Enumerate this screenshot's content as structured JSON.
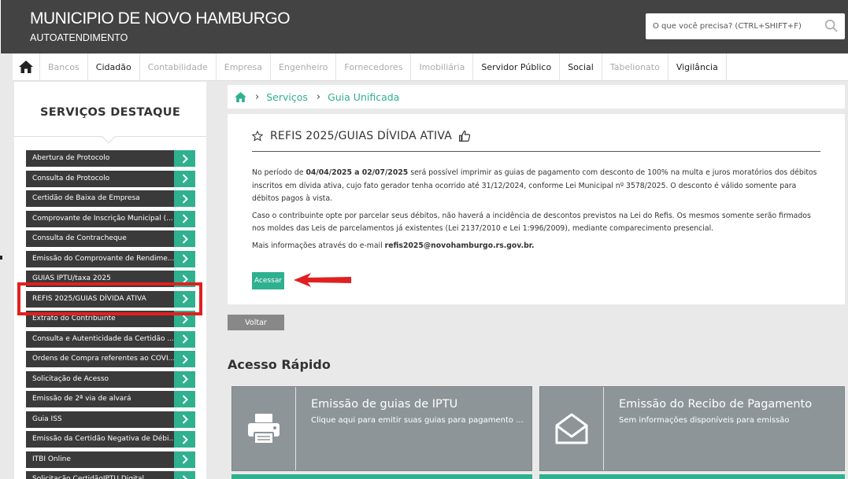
{
  "header": {
    "title": "MUNICIPIO DE NOVO HAMBURGO",
    "subtitle": "AUTOATENDIMENTO",
    "search_placeholder": "O que você precisa? (CTRL+SHIFT+F)"
  },
  "nav": {
    "items": [
      {
        "label": "Bancos",
        "style": "dim"
      },
      {
        "label": "Cidadão",
        "style": "dark"
      },
      {
        "label": "Contabilidade",
        "style": "dim"
      },
      {
        "label": "Empresa",
        "style": "dim"
      },
      {
        "label": "Engenheiro",
        "style": "dim"
      },
      {
        "label": "Fornecedores",
        "style": "dim"
      },
      {
        "label": "Imobiliária",
        "style": "dim"
      },
      {
        "label": "Servidor Público",
        "style": "dark"
      },
      {
        "label": "Social",
        "style": "dark"
      },
      {
        "label": "Tabelionato",
        "style": "dim"
      },
      {
        "label": "Vigilância",
        "style": "dark"
      }
    ]
  },
  "sidebar": {
    "title": "SERVIÇOS DESTAQUE",
    "items": [
      {
        "label": "Abertura de Protocolo"
      },
      {
        "label": "Consulta de Protocolo"
      },
      {
        "label": "Certidão de Baixa de Empresa"
      },
      {
        "label": "Comprovante de Inscrição Municipal (..."
      },
      {
        "label": "Consulta de Contracheque"
      },
      {
        "label": "Emissão do Comprovante de Rendime..."
      },
      {
        "label": "GUIAS IPTU/taxa 2025"
      },
      {
        "label": "REFIS 2025/GUIAS DÍVIDA ATIVA"
      },
      {
        "label": "Extrato do Contribuinte"
      },
      {
        "label": "Consulta e Autenticidade da Certidão ..."
      },
      {
        "label": "Ordens de Compra referentes ao COVI..."
      },
      {
        "label": "Solicitação de Acesso"
      },
      {
        "label": "Emissão de 2ª via de alvará"
      },
      {
        "label": "Guia ISS"
      },
      {
        "label": "Emissão da Certidão Negativa de Débi..."
      },
      {
        "label": "ITBI Online"
      },
      {
        "label": "Solicitação CertidãoIPTU Digital"
      }
    ]
  },
  "breadcrumb": {
    "items": [
      "Serviços",
      "Guia Unificada"
    ]
  },
  "card": {
    "title": "REFIS 2025/GUIAS DÍVIDA ATIVA",
    "p1_pre": "No período de ",
    "p1_bold": "04/04/2025 a 02/07/2025",
    "p1_post": " será possível imprimir as guias de pagamento com desconto de 100% na multa e juros moratórios dos débitos inscritos em dívida ativa, cujo fato gerador tenha ocorrido até 31/12/2024, conforme Lei Municipal nº 3578/2025. O desconto é válido somente para débitos pagos à vista.",
    "p2": "Caso o contribuinte opte por parcelar seus débitos, não haverá a incidência de descontos previstos na Lei do Refis. Os mesmos somente serão firmados nos moldes das Leis de parcelamentos já existentes (Lei 2137/2010 e Lei 1:996/2009), mediante comparecimento presencial.",
    "p3_pre": "Mais informações através do e-mail ",
    "p3_bold": "refis2025@novohamburgo.rs.gov.br.",
    "button": "Acessar"
  },
  "voltar": "Voltar",
  "acesso": {
    "title": "Acesso Rápido",
    "tiles": [
      {
        "title": "Emissão de guias de IPTU",
        "desc": "Clique aqui para emitir suas guias para pagamento ...",
        "icon": "printer-icon"
      },
      {
        "title": "Emissão do Recibo de Pagamento",
        "desc": "Sem informações disponíveis para emissão",
        "icon": "envelope-icon"
      }
    ]
  },
  "colors": {
    "accent": "#2fb08e",
    "header": "#434343",
    "highlight": "#e02020"
  }
}
